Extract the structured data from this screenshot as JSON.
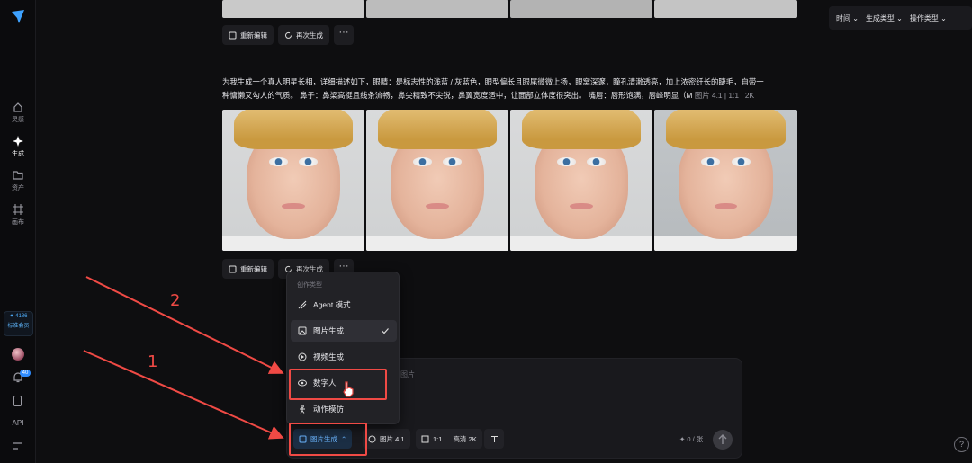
{
  "rail": {
    "items": [
      {
        "label": "灵感",
        "icon": "lightbulb-icon"
      },
      {
        "label": "生成",
        "icon": "sparkle-icon"
      },
      {
        "label": "资产",
        "icon": "folder-icon"
      },
      {
        "label": "画布",
        "icon": "canvas-icon"
      }
    ],
    "credits": "✦ 4186",
    "membership": "标准会员",
    "notification_count": "40",
    "api_label": "API"
  },
  "filters": {
    "time": "时间",
    "gen_type": "生成类型",
    "op_type": "操作类型"
  },
  "actions": {
    "reedit": "重新编辑",
    "regenerate": "再次生成",
    "more": "···"
  },
  "prompt": {
    "line1": "为我生成一个真人明星长相，详细描述如下，眼睛：是标志性的浅蓝 / 灰蓝色，眼型偏长且眼尾微微上扬，眼窝深邃，瞳孔清澈透亮，加上浓密纤长的睫毛，自带一",
    "line2": "种慵懒又勾人的气质。 鼻子：鼻梁高挺且线条流畅，鼻尖精致不尖锐，鼻翼宽度适中，让面部立体度很突出。 嘴唇：唇形饱满，唇峰明显（M",
    "meta": "图片 4.1  |  1:1  |  2K"
  },
  "menu": {
    "header": "创作类型",
    "items": [
      {
        "label": "Agent 模式",
        "icon": "agent-icon"
      },
      {
        "label": "图片生成",
        "icon": "image-icon",
        "selected": true
      },
      {
        "label": "视频生成",
        "icon": "video-icon"
      },
      {
        "label": "数字人",
        "icon": "digital-human-icon"
      },
      {
        "label": "动作模仿",
        "icon": "motion-icon"
      }
    ]
  },
  "composer": {
    "placeholder": "图片",
    "mode": "图片生成",
    "model": "图片 4.1",
    "ratio": "1:1",
    "quality": "高清 2K",
    "count": "0 / 张"
  },
  "annotations": {
    "one": "1",
    "two": "2",
    "color": "#f04a45"
  },
  "help": "?"
}
